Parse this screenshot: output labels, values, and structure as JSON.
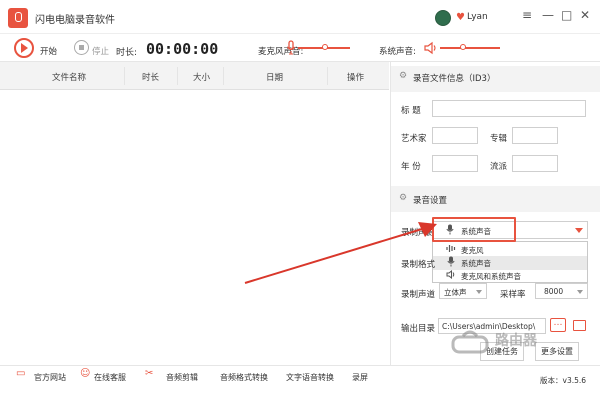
{
  "window": {
    "title": "闪电电脑录音软件",
    "user_name": "Lyan",
    "menu_icon": "≡",
    "minimize_icon": "—",
    "maximize_icon": "□",
    "close_icon": "✕"
  },
  "toolbar": {
    "start_label": "开始",
    "stop_label": "停止",
    "duration_label": "时长:",
    "timer": "00:00:00",
    "mic_volume_label": "麦克风声音:",
    "system_volume_label": "系统声音:"
  },
  "file_table": {
    "columns": [
      "文件名称",
      "时长",
      "大小",
      "日期",
      "操作"
    ],
    "rows": []
  },
  "id3": {
    "section_title": "录音文件信息（ID3）",
    "title_label": "标 题",
    "artist_label": "艺术家",
    "album_label": "专辑",
    "year_label": "年 份",
    "genre_label": "流派"
  },
  "recording_settings": {
    "section_title": "录音设置",
    "source_label": "录制声源",
    "source_value": "系统声音",
    "source_options": [
      "麦克风",
      "系统声音",
      "麦克风和系统声音"
    ],
    "format_label": "录制格式",
    "channel_label": "录制声道",
    "channel_value": "立体声",
    "sample_rate_label": "采样率",
    "sample_rate_value": "8000",
    "output_label": "输出目录",
    "output_value": "C:\\Users\\admin\\Desktop\\",
    "more_label": "…",
    "create_label": "创建任务",
    "more_settings_label": "更多设置"
  },
  "statusbar": {
    "items": [
      "官方网站",
      "在线客服",
      "音频剪辑",
      "音频格式转换",
      "文字语音转换",
      "录屏"
    ],
    "version": "版本：v3.5.6"
  },
  "watermark": {
    "text": "路由器"
  },
  "colors": {
    "accent": "#e8533f",
    "arrow": "#d9372b",
    "panel_gray": "#f3f3f3"
  }
}
